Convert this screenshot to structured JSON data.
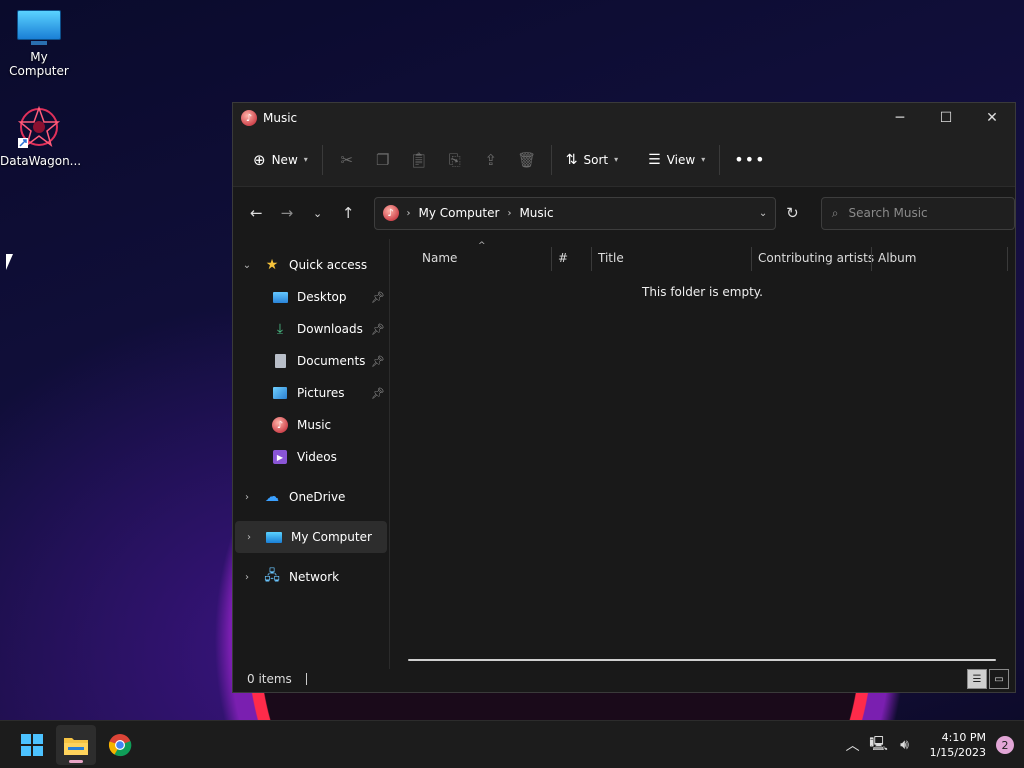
{
  "desktop": {
    "icons": [
      {
        "label": "My Computer"
      },
      {
        "label": "DataWagon..."
      }
    ]
  },
  "window": {
    "title": "Music",
    "toolbar": {
      "new_label": "New",
      "sort_label": "Sort",
      "view_label": "View"
    },
    "address": {
      "crumbs": [
        "My Computer",
        "Music"
      ]
    },
    "search": {
      "placeholder": "Search Music"
    },
    "nav": {
      "quick_access": "Quick access",
      "quick_items": [
        "Desktop",
        "Downloads",
        "Documents",
        "Pictures",
        "Music",
        "Videos"
      ],
      "onedrive": "OneDrive",
      "my_computer": "My Computer",
      "network": "Network"
    },
    "columns": [
      "Name",
      "#",
      "Title",
      "Contributing artists",
      "Album"
    ],
    "empty_message": "This folder is empty.",
    "status": {
      "items": "0 items"
    }
  },
  "taskbar": {
    "time": "4:10 PM",
    "date": "1/15/2023",
    "notifications": "2"
  },
  "colors": {
    "accent": "#e9a4c6",
    "window_bg": "#191919",
    "toolbar_bg": "#202020"
  }
}
